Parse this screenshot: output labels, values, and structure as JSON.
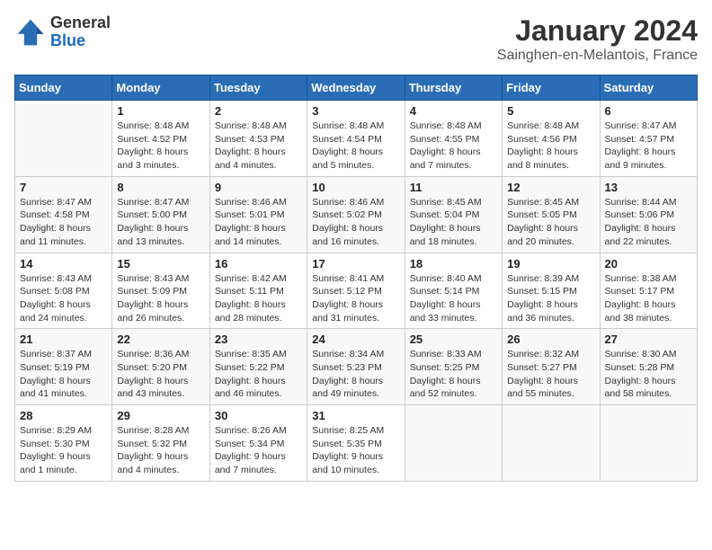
{
  "logo": {
    "general": "General",
    "blue": "Blue"
  },
  "title": "January 2024",
  "subtitle": "Sainghen-en-Melantois, France",
  "days_of_week": [
    "Sunday",
    "Monday",
    "Tuesday",
    "Wednesday",
    "Thursday",
    "Friday",
    "Saturday"
  ],
  "weeks": [
    [
      {
        "day": "",
        "info": ""
      },
      {
        "day": "1",
        "info": "Sunrise: 8:48 AM\nSunset: 4:52 PM\nDaylight: 8 hours\nand 3 minutes."
      },
      {
        "day": "2",
        "info": "Sunrise: 8:48 AM\nSunset: 4:53 PM\nDaylight: 8 hours\nand 4 minutes."
      },
      {
        "day": "3",
        "info": "Sunrise: 8:48 AM\nSunset: 4:54 PM\nDaylight: 8 hours\nand 5 minutes."
      },
      {
        "day": "4",
        "info": "Sunrise: 8:48 AM\nSunset: 4:55 PM\nDaylight: 8 hours\nand 7 minutes."
      },
      {
        "day": "5",
        "info": "Sunrise: 8:48 AM\nSunset: 4:56 PM\nDaylight: 8 hours\nand 8 minutes."
      },
      {
        "day": "6",
        "info": "Sunrise: 8:47 AM\nSunset: 4:57 PM\nDaylight: 8 hours\nand 9 minutes."
      }
    ],
    [
      {
        "day": "7",
        "info": "Sunrise: 8:47 AM\nSunset: 4:58 PM\nDaylight: 8 hours\nand 11 minutes."
      },
      {
        "day": "8",
        "info": "Sunrise: 8:47 AM\nSunset: 5:00 PM\nDaylight: 8 hours\nand 13 minutes."
      },
      {
        "day": "9",
        "info": "Sunrise: 8:46 AM\nSunset: 5:01 PM\nDaylight: 8 hours\nand 14 minutes."
      },
      {
        "day": "10",
        "info": "Sunrise: 8:46 AM\nSunset: 5:02 PM\nDaylight: 8 hours\nand 16 minutes."
      },
      {
        "day": "11",
        "info": "Sunrise: 8:45 AM\nSunset: 5:04 PM\nDaylight: 8 hours\nand 18 minutes."
      },
      {
        "day": "12",
        "info": "Sunrise: 8:45 AM\nSunset: 5:05 PM\nDaylight: 8 hours\nand 20 minutes."
      },
      {
        "day": "13",
        "info": "Sunrise: 8:44 AM\nSunset: 5:06 PM\nDaylight: 8 hours\nand 22 minutes."
      }
    ],
    [
      {
        "day": "14",
        "info": "Sunrise: 8:43 AM\nSunset: 5:08 PM\nDaylight: 8 hours\nand 24 minutes."
      },
      {
        "day": "15",
        "info": "Sunrise: 8:43 AM\nSunset: 5:09 PM\nDaylight: 8 hours\nand 26 minutes."
      },
      {
        "day": "16",
        "info": "Sunrise: 8:42 AM\nSunset: 5:11 PM\nDaylight: 8 hours\nand 28 minutes."
      },
      {
        "day": "17",
        "info": "Sunrise: 8:41 AM\nSunset: 5:12 PM\nDaylight: 8 hours\nand 31 minutes."
      },
      {
        "day": "18",
        "info": "Sunrise: 8:40 AM\nSunset: 5:14 PM\nDaylight: 8 hours\nand 33 minutes."
      },
      {
        "day": "19",
        "info": "Sunrise: 8:39 AM\nSunset: 5:15 PM\nDaylight: 8 hours\nand 36 minutes."
      },
      {
        "day": "20",
        "info": "Sunrise: 8:38 AM\nSunset: 5:17 PM\nDaylight: 8 hours\nand 38 minutes."
      }
    ],
    [
      {
        "day": "21",
        "info": "Sunrise: 8:37 AM\nSunset: 5:19 PM\nDaylight: 8 hours\nand 41 minutes."
      },
      {
        "day": "22",
        "info": "Sunrise: 8:36 AM\nSunset: 5:20 PM\nDaylight: 8 hours\nand 43 minutes."
      },
      {
        "day": "23",
        "info": "Sunrise: 8:35 AM\nSunset: 5:22 PM\nDaylight: 8 hours\nand 46 minutes."
      },
      {
        "day": "24",
        "info": "Sunrise: 8:34 AM\nSunset: 5:23 PM\nDaylight: 8 hours\nand 49 minutes."
      },
      {
        "day": "25",
        "info": "Sunrise: 8:33 AM\nSunset: 5:25 PM\nDaylight: 8 hours\nand 52 minutes."
      },
      {
        "day": "26",
        "info": "Sunrise: 8:32 AM\nSunset: 5:27 PM\nDaylight: 8 hours\nand 55 minutes."
      },
      {
        "day": "27",
        "info": "Sunrise: 8:30 AM\nSunset: 5:28 PM\nDaylight: 8 hours\nand 58 minutes."
      }
    ],
    [
      {
        "day": "28",
        "info": "Sunrise: 8:29 AM\nSunset: 5:30 PM\nDaylight: 9 hours\nand 1 minute."
      },
      {
        "day": "29",
        "info": "Sunrise: 8:28 AM\nSunset: 5:32 PM\nDaylight: 9 hours\nand 4 minutes."
      },
      {
        "day": "30",
        "info": "Sunrise: 8:26 AM\nSunset: 5:34 PM\nDaylight: 9 hours\nand 7 minutes."
      },
      {
        "day": "31",
        "info": "Sunrise: 8:25 AM\nSunset: 5:35 PM\nDaylight: 9 hours\nand 10 minutes."
      },
      {
        "day": "",
        "info": ""
      },
      {
        "day": "",
        "info": ""
      },
      {
        "day": "",
        "info": ""
      }
    ]
  ]
}
